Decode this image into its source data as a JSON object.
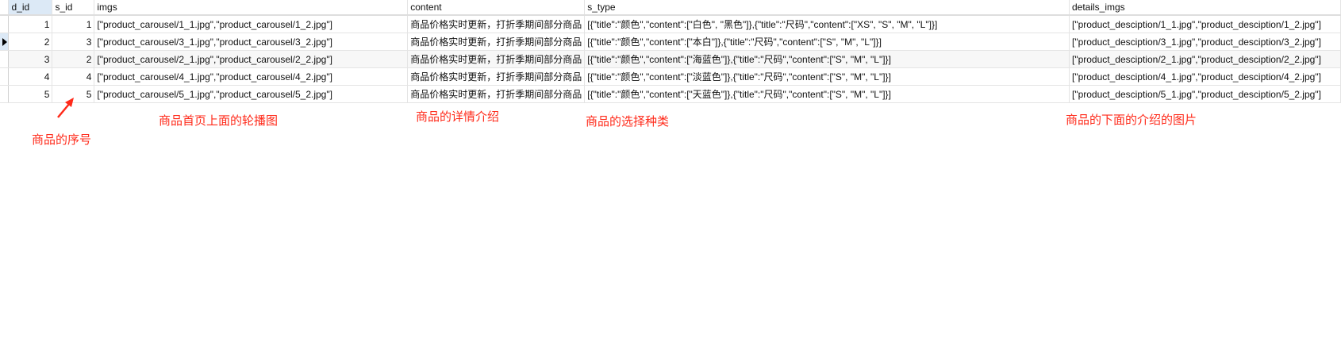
{
  "columns": [
    "d_id",
    "s_id",
    "imgs",
    "content",
    "s_type",
    "details_imgs"
  ],
  "rows": [
    {
      "d_id": "1",
      "s_id": "1",
      "imgs": "[\"product_carousel/1_1.jpg\",\"product_carousel/1_2.jpg\"]",
      "content": "商品价格实时更新，打折季期间部分商品",
      "s_type": "[{\"title\":\"颜色\",\"content\":[\"白色\", \"黑色\"]},{\"title\":\"尺码\",\"content\":[\"XS\", \"S\", \"M\", \"L\"]}]",
      "details_imgs": "[\"product_desciption/1_1.jpg\",\"product_desciption/1_2.jpg\"]"
    },
    {
      "d_id": "2",
      "s_id": "3",
      "imgs": "[\"product_carousel/3_1.jpg\",\"product_carousel/3_2.jpg\"]",
      "content": "商品价格实时更新，打折季期间部分商品",
      "s_type": "[{\"title\":\"颜色\",\"content\":[\"本白\"]},{\"title\":\"尺码\",\"content\":[\"S\", \"M\", \"L\"]}]",
      "details_imgs": "[\"product_desciption/3_1.jpg\",\"product_desciption/3_2.jpg\"]"
    },
    {
      "d_id": "3",
      "s_id": "2",
      "imgs": "[\"product_carousel/2_1.jpg\",\"product_carousel/2_2.jpg\"]",
      "content": "商品价格实时更新，打折季期间部分商品",
      "s_type": "[{\"title\":\"颜色\",\"content\":[\"海蓝色\"]},{\"title\":\"尺码\",\"content\":[\"S\", \"M\", \"L\"]}]",
      "details_imgs": "[\"product_desciption/2_1.jpg\",\"product_desciption/2_2.jpg\"]"
    },
    {
      "d_id": "4",
      "s_id": "4",
      "imgs": "[\"product_carousel/4_1.jpg\",\"product_carousel/4_2.jpg\"]",
      "content": "商品价格实时更新，打折季期间部分商品",
      "s_type": "[{\"title\":\"颜色\",\"content\":[\"淡蓝色\"]},{\"title\":\"尺码\",\"content\":[\"S\", \"M\", \"L\"]}]",
      "details_imgs": "[\"product_desciption/4_1.jpg\",\"product_desciption/4_2.jpg\"]"
    },
    {
      "d_id": "5",
      "s_id": "5",
      "imgs": "[\"product_carousel/5_1.jpg\",\"product_carousel/5_2.jpg\"]",
      "content": "商品价格实时更新，打折季期间部分商品",
      "s_type": "[{\"title\":\"颜色\",\"content\":[\"天蓝色\"]},{\"title\":\"尺码\",\"content\":[\"S\", \"M\", \"L\"]}]",
      "details_imgs": "[\"product_desciption/5_1.jpg\",\"product_desciption/5_2.jpg\"]"
    }
  ],
  "current_row": 2,
  "annotations": {
    "d_id": "商品的序号",
    "imgs": "商品首页上面的轮播图",
    "content": "商品的详情介绍",
    "s_type": "商品的选择种类",
    "details_imgs": "商品的下面的介绍的图片"
  },
  "colors": {
    "annotation": "#ff2a1a",
    "selection": "#dce9f6"
  }
}
